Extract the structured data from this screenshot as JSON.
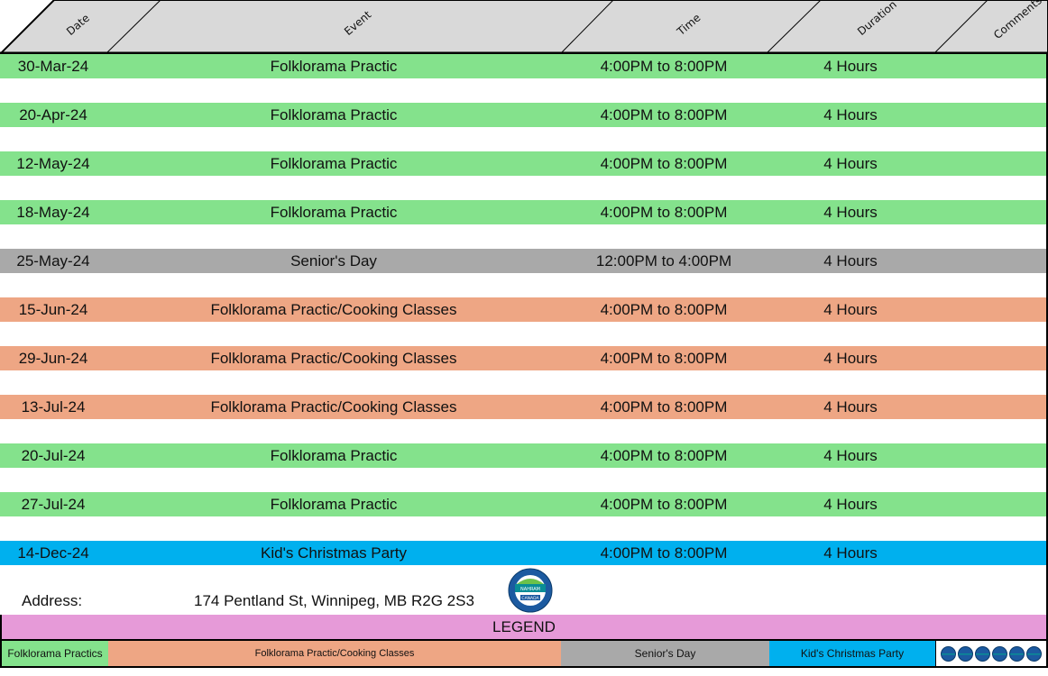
{
  "headers": {
    "date": "Date",
    "event": "Event",
    "time": "Time",
    "duration": "Duration",
    "comments": "Comments"
  },
  "rows": [
    {
      "date": "30-Mar-24",
      "event": "Folklorama Practic",
      "time": "4:00PM to 8:00PM",
      "duration": "4 Hours",
      "comments": "",
      "category": "green"
    },
    {
      "date": "20-Apr-24",
      "event": "Folklorama Practic",
      "time": "4:00PM to 8:00PM",
      "duration": "4 Hours",
      "comments": "",
      "category": "green"
    },
    {
      "date": "12-May-24",
      "event": "Folklorama Practic",
      "time": "4:00PM to 8:00PM",
      "duration": "4 Hours",
      "comments": "",
      "category": "green"
    },
    {
      "date": "18-May-24",
      "event": "Folklorama Practic",
      "time": "4:00PM to 8:00PM",
      "duration": "4 Hours",
      "comments": "",
      "category": "green"
    },
    {
      "date": "25-May-24",
      "event": "Senior's Day",
      "time": "12:00PM to 4:00PM",
      "duration": "4 Hours",
      "comments": "",
      "category": "gray"
    },
    {
      "date": "15-Jun-24",
      "event": "Folklorama Practic/Cooking Classes",
      "time": "4:00PM to 8:00PM",
      "duration": "4 Hours",
      "comments": "",
      "category": "orange"
    },
    {
      "date": "29-Jun-24",
      "event": "Folklorama Practic/Cooking Classes",
      "time": "4:00PM to 8:00PM",
      "duration": "4 Hours",
      "comments": "",
      "category": "orange"
    },
    {
      "date": "13-Jul-24",
      "event": "Folklorama Practic/Cooking Classes",
      "time": "4:00PM to 8:00PM",
      "duration": "4 Hours",
      "comments": "",
      "category": "orange"
    },
    {
      "date": "20-Jul-24",
      "event": "Folklorama Practic",
      "time": "4:00PM to 8:00PM",
      "duration": "4 Hours",
      "comments": "",
      "category": "green"
    },
    {
      "date": "27-Jul-24",
      "event": "Folklorama Practic",
      "time": "4:00PM to 8:00PM",
      "duration": "4 Hours",
      "comments": "",
      "category": "green"
    },
    {
      "date": "14-Dec-24",
      "event": "Kid's Christmas Party",
      "time": "4:00PM to 8:00PM",
      "duration": "4 Hours",
      "comments": "",
      "category": "blue"
    }
  ],
  "address": {
    "label": "Address:",
    "value": "174 Pentland St, Winnipeg, MB R2G 2S3"
  },
  "logo": {
    "icon": "organization-seal-icon",
    "text_top": "NAHRAM",
    "text_bottom": "CANADA"
  },
  "legend": {
    "title": "LEGEND",
    "items": [
      {
        "label": "Folklorama Practics",
        "color": "#84e28c"
      },
      {
        "label": "Folklorama Practic/Cooking Classes",
        "color": "#eea684"
      },
      {
        "label": "Senior's Day",
        "color": "#a9a9a9"
      },
      {
        "label": "Kid's Christmas Party",
        "color": "#00b0ee"
      }
    ],
    "logo_icons": "mini-logo-row-icon"
  },
  "colors": {
    "green": "#84e28c",
    "gray": "#a9a9a9",
    "orange": "#eea684",
    "blue": "#00b0ee",
    "legend_bg": "#e69ad8",
    "header_bg": "#d9d9d9"
  }
}
